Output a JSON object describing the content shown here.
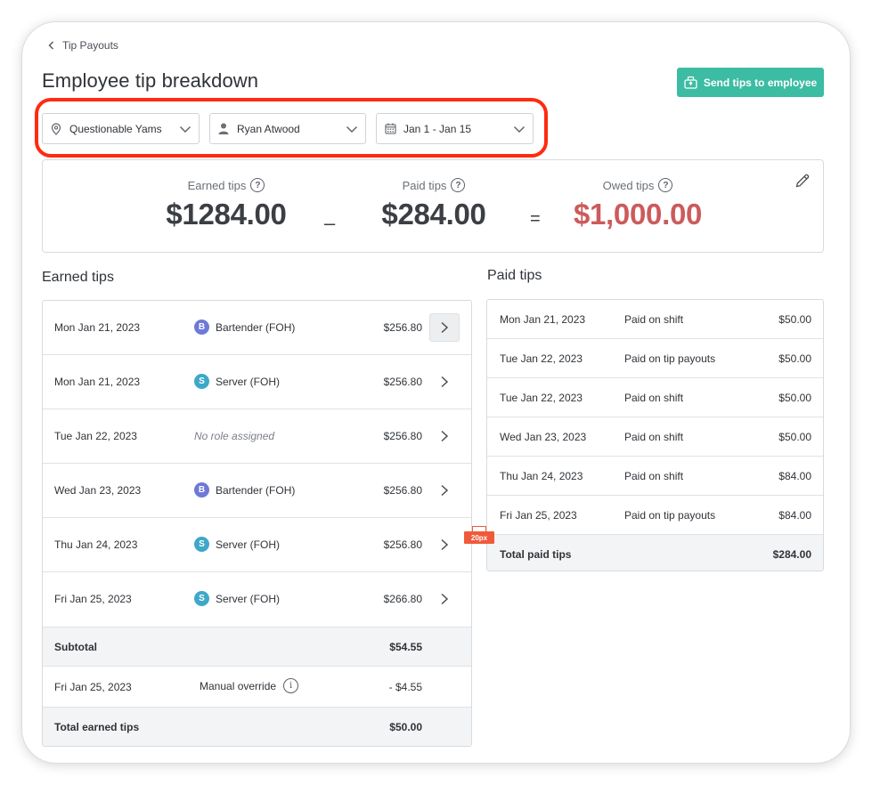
{
  "breadcrumb": {
    "label": "Tip Payouts"
  },
  "page": {
    "title": "Employee tip breakdown"
  },
  "actions": {
    "send_label": "Send tips to employee"
  },
  "filters": {
    "location": "Questionable Yams",
    "employee": "Ryan Atwood",
    "date_range": "Jan 1 - Jan 15"
  },
  "summary": {
    "earned_label": "Earned tips",
    "earned_value": "$1284.00",
    "minus": "–",
    "paid_label": "Paid tips",
    "paid_value": "$284.00",
    "equals": "=",
    "owed_label": "Owed tips",
    "owed_value": "$1,000.00",
    "help_glyph": "?"
  },
  "earned": {
    "title": "Earned tips",
    "rows": [
      {
        "date": "Mon Jan 21, 2023",
        "badge": "B",
        "role": "Bartender (FOH)",
        "amount": "$256.80"
      },
      {
        "date": "Mon Jan 21, 2023",
        "badge": "S",
        "role": "Server (FOH)",
        "amount": "$256.80"
      },
      {
        "date": "Tue Jan 22, 2023",
        "badge": "",
        "role": "No role assigned",
        "amount": "$256.80"
      },
      {
        "date": "Wed Jan 23, 2023",
        "badge": "B",
        "role": "Bartender (FOH)",
        "amount": "$256.80"
      },
      {
        "date": "Thu Jan 24, 2023",
        "badge": "S",
        "role": "Server (FOH)",
        "amount": "$256.80"
      },
      {
        "date": "Fri Jan 25, 2023",
        "badge": "S",
        "role": "Server (FOH)",
        "amount": "$266.80"
      }
    ],
    "subtotal_label": "Subtotal",
    "subtotal_value": "$54.55",
    "override": {
      "date": "Fri Jan 25, 2023",
      "label": "Manual override",
      "info_glyph": "i",
      "amount": "- $4.55"
    },
    "total_label": "Total earned tips",
    "total_value": "$50.00"
  },
  "paid": {
    "title": "Paid tips",
    "rows": [
      {
        "date": "Mon Jan 21, 2023",
        "type": "Paid on shift",
        "amount": "$50.00"
      },
      {
        "date": "Tue Jan 22, 2023",
        "type": "Paid on tip payouts",
        "amount": "$50.00"
      },
      {
        "date": "Tue Jan 22, 2023",
        "type": "Paid on shift",
        "amount": "$50.00"
      },
      {
        "date": "Wed Jan 23, 2023",
        "type": "Paid on shift",
        "amount": "$50.00"
      },
      {
        "date": "Thu Jan 24, 2023",
        "type": "Paid on shift",
        "amount": "$84.00"
      },
      {
        "date": "Fri Jan 25, 2023",
        "type": "Paid on tip payouts",
        "amount": "$84.00"
      }
    ],
    "total_label": "Total paid tips",
    "total_value": "$284.00"
  },
  "annotation": {
    "spacing": "20px"
  },
  "colors": {
    "accent": "#3cbca3",
    "owed": "#cc5b5b",
    "highlight": "#ff2a10",
    "bartender_badge": "#6e79d8",
    "server_badge": "#3ea8c8"
  }
}
